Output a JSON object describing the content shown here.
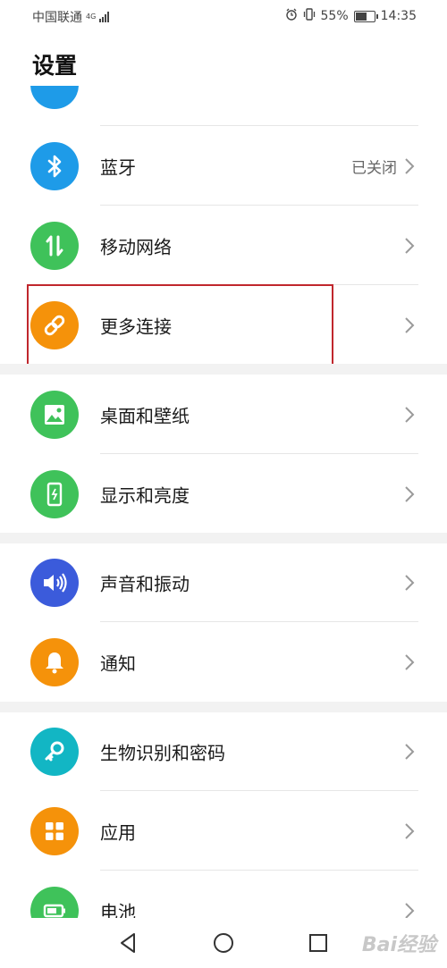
{
  "status_bar": {
    "carrier": "中国联通",
    "network": "4G",
    "battery": "55%",
    "battery_level": 0.55,
    "time": "14:35"
  },
  "page": {
    "title": "设置"
  },
  "items": [
    {
      "label": "蓝牙",
      "value": "已关闭",
      "icon": "bluetooth-icon",
      "color": "#1e9be8"
    },
    {
      "label": "移动网络",
      "value": "",
      "icon": "mobile-data-icon",
      "color": "#3fc25a"
    },
    {
      "label": "更多连接",
      "value": "",
      "icon": "link-icon",
      "color": "#f5920a"
    },
    {
      "label": "桌面和壁纸",
      "value": "",
      "icon": "wallpaper-icon",
      "color": "#3fc25a"
    },
    {
      "label": "显示和亮度",
      "value": "",
      "icon": "display-icon",
      "color": "#3fc25a"
    },
    {
      "label": "声音和振动",
      "value": "",
      "icon": "sound-icon",
      "color": "#3b5bdb"
    },
    {
      "label": "通知",
      "value": "",
      "icon": "bell-icon",
      "color": "#f5920a"
    },
    {
      "label": "生物识别和密码",
      "value": "",
      "icon": "key-icon",
      "color": "#12b6c4"
    },
    {
      "label": "应用",
      "value": "",
      "icon": "apps-icon",
      "color": "#f5920a"
    },
    {
      "label": "电池",
      "value": "",
      "icon": "battery-icon",
      "color": "#3fc25a"
    }
  ],
  "watermark": "Bai经验",
  "colors": {
    "highlight": "#c0272d",
    "section_gap": "#f2f2f2"
  }
}
